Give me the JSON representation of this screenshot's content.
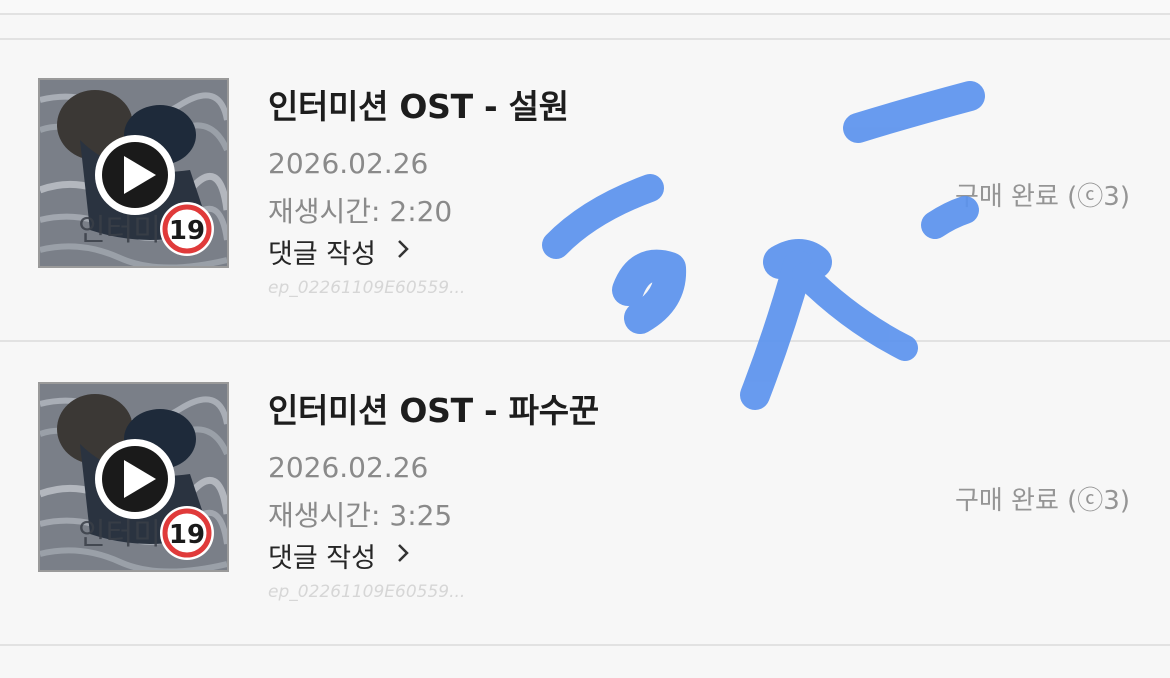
{
  "episodes": [
    {
      "title": "인터미션 OST - 설원",
      "date": "2026.02.26",
      "duration": "재생시간: 2:20",
      "comment_label": "댓글 작성",
      "episode_id": "ep_02261109E60559...",
      "status": "구매 완료 (ⓒ3)",
      "age_rating": "19",
      "cover_text": "인터미"
    },
    {
      "title": "인터미션 OST - 파수꾼",
      "date": "2026.02.26",
      "duration": "재생시간: 3:25",
      "comment_label": "댓글 작성",
      "episode_id": "ep_02261109E60559...",
      "status": "구매 완료 (ⓒ3)",
      "age_rating": "19",
      "cover_text": "인터미"
    }
  ],
  "colors": {
    "background": "#f7f7f7",
    "divider": "#e2e2e2",
    "overlay_scribble": "#5b93ee",
    "age_badge_ring": "#e03a3a"
  },
  "icons": {
    "play": "play-icon",
    "chevron": "chevron-right-icon",
    "age": "age-19-badge"
  }
}
